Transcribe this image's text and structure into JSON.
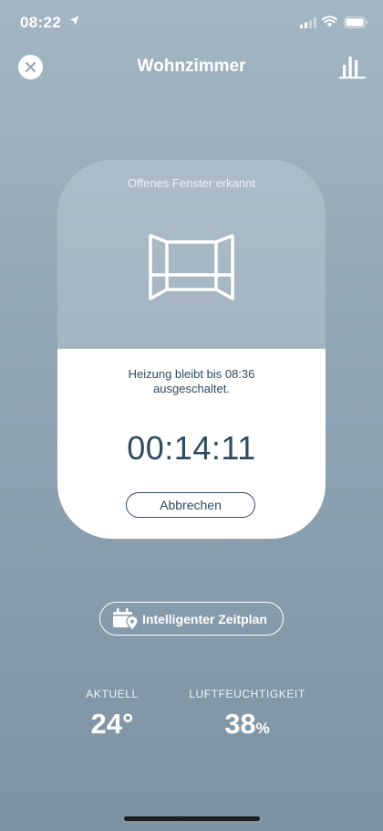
{
  "status_bar": {
    "time": "08:22",
    "location_icon": "location-arrow-icon",
    "signal_icon": "cellular-signal-icon",
    "wifi_icon": "wifi-icon",
    "battery_icon": "battery-icon"
  },
  "header": {
    "title": "Wohnzimmer",
    "close_icon": "close-icon",
    "stats_icon": "bar-chart-icon"
  },
  "card": {
    "heading": "Offenes Fenster erkannt",
    "icon": "open-window-icon",
    "info_text": "Heizung bleibt bis 08:36\nausgeschaltet.",
    "countdown": "00:14:11",
    "cancel_label": "Abbrechen"
  },
  "schedule": {
    "label": "Intelligenter Zeitplan",
    "icon": "calendar-location-icon"
  },
  "stats": {
    "current": {
      "label": "AKTUELL",
      "value": "24°"
    },
    "humidity": {
      "label": "LUFTFEUCHTIGKEIT",
      "value": "38",
      "unit": "%"
    }
  },
  "colors": {
    "card_text": "#2d4a5e",
    "background_top": "#a3b6c3",
    "background_bottom": "#7d93a4"
  }
}
